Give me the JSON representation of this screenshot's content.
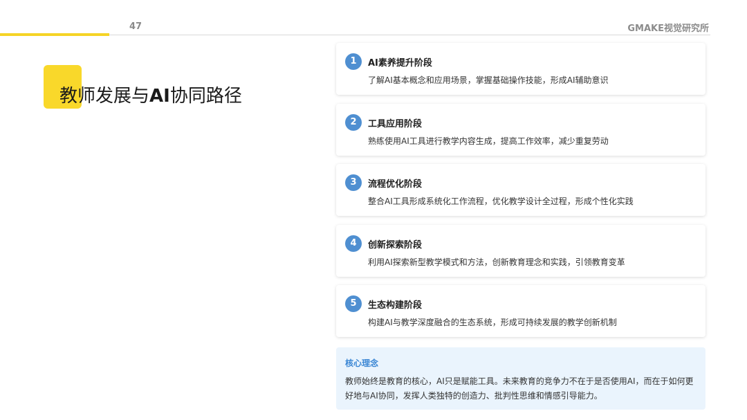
{
  "header": {
    "page_number": "47",
    "brand": "GMAKE视觉研究所"
  },
  "slide": {
    "title_prefix": "教师发展与",
    "title_bold": "AI",
    "title_suffix": "协同路径"
  },
  "stages": [
    {
      "number": "1",
      "title": "AI素养提升阶段",
      "description": "了解AI基本概念和应用场景，掌握基础操作技能，形成AI辅助意识"
    },
    {
      "number": "2",
      "title": "工具应用阶段",
      "description": "熟练使用AI工具进行教学内容生成，提高工作效率，减少重复劳动"
    },
    {
      "number": "3",
      "title": "流程优化阶段",
      "description": "整合AI工具形成系统化工作流程，优化教学设计全过程，形成个性化实践"
    },
    {
      "number": "4",
      "title": "创新探索阶段",
      "description": "利用AI探索新型教学模式和方法，创新教育理念和实践，引领教育变革"
    },
    {
      "number": "5",
      "title": "生态构建阶段",
      "description": "构建AI与教学深度融合的生态系统，形成可持续发展的教学创新机制"
    }
  ],
  "core": {
    "title": "核心理念",
    "text": "教师始终是教育的核心，AI只是赋能工具。未来教育的竞争力不在于是否使用AI，而在于如何更好地与AI协同，发挥人类独特的创造力、批判性思维和情感引导能力。"
  },
  "colors": {
    "accent_yellow": "#f9d82a",
    "stage_blue": "#4f8fd1",
    "core_title_blue": "#3a86d4",
    "core_bg": "#eaf4fd"
  }
}
